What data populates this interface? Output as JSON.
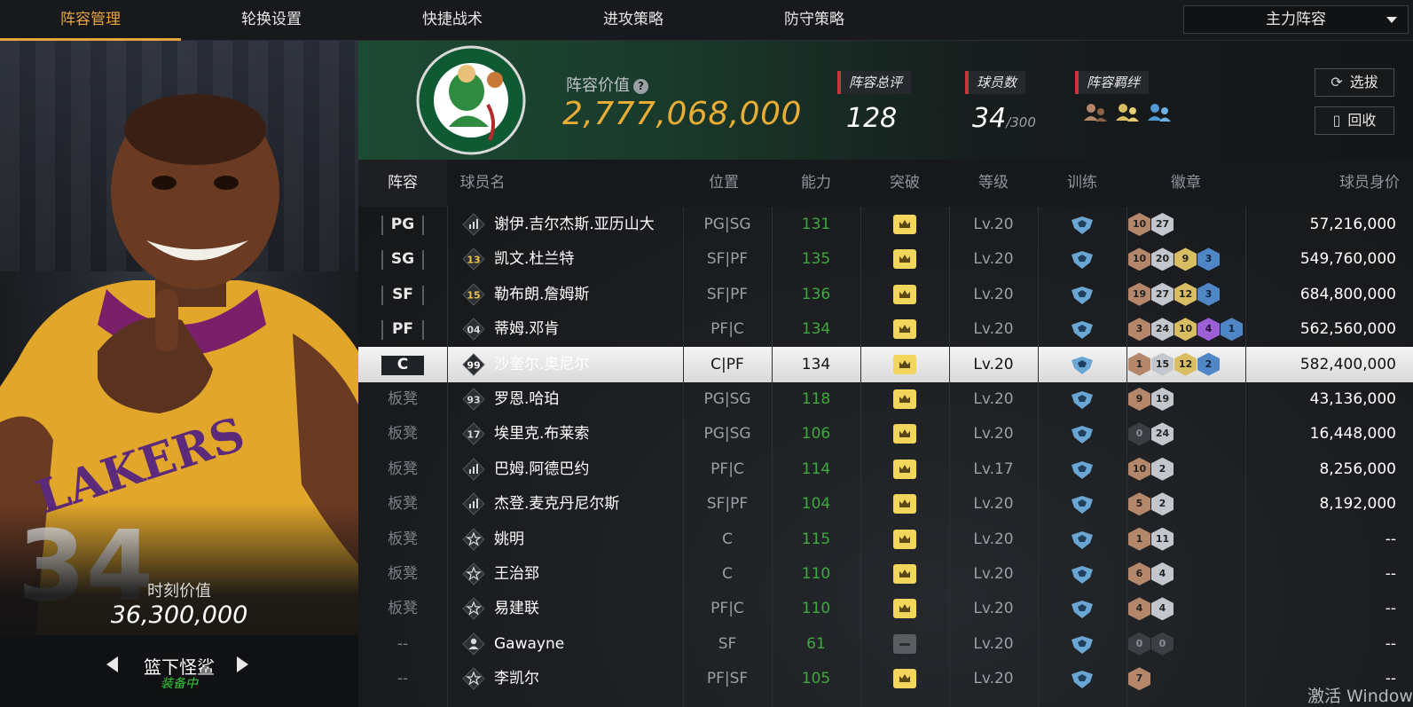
{
  "tabs": [
    {
      "label": "阵容管理",
      "active": true
    },
    {
      "label": "轮换设置",
      "active": false
    },
    {
      "label": "快捷战术",
      "active": false
    },
    {
      "label": "进攻策略",
      "active": false
    },
    {
      "label": "防守策略",
      "active": false
    }
  ],
  "lineup_select": {
    "value": "主力阵容"
  },
  "player_card": {
    "moment_label": "时刻价值",
    "moment_value": "36,300,000",
    "card_name": "篮下怪鲨",
    "status": "装备中"
  },
  "team": {
    "value_label": "阵容价值",
    "value": "2,777,068,000",
    "rating_label": "阵容总评",
    "rating": "128",
    "players_label": "球员数",
    "players": "34",
    "players_max": "/300",
    "bond_label": "阵容羁绊",
    "bond_icons": [
      "bond-bronze-icon",
      "bond-gold-icon",
      "bond-blue-icon"
    ],
    "scout_button": "选拔",
    "recycle_button": "回收"
  },
  "columns": [
    "阵容",
    "球员名",
    "位置",
    "能力",
    "突破",
    "等级",
    "训练",
    "徽章",
    "球员身价"
  ],
  "rows": [
    {
      "slot": "PG",
      "slot_type": "starter",
      "num_icon": "stat",
      "name": "谢伊.吉尔杰斯.亚历山大",
      "pos": "PG|SG",
      "ability": "131",
      "breakthrough": "crown",
      "level": "Lv.20",
      "badges": [
        [
          "10",
          "bronze"
        ],
        [
          "27",
          "silver"
        ]
      ],
      "value": "57,216,000"
    },
    {
      "slot": "SG",
      "slot_type": "starter",
      "num_icon": "13",
      "name": "凯文.杜兰特",
      "pos": "SF|PF",
      "ability": "135",
      "breakthrough": "crown",
      "level": "Lv.20",
      "badges": [
        [
          "10",
          "bronze"
        ],
        [
          "20",
          "silver"
        ],
        [
          "9",
          "gold"
        ],
        [
          "3",
          "blue"
        ]
      ],
      "value": "549,760,000"
    },
    {
      "slot": "SF",
      "slot_type": "starter",
      "num_icon": "15",
      "name": "勒布朗.詹姆斯",
      "pos": "SF|PF",
      "ability": "136",
      "breakthrough": "crown",
      "level": "Lv.20",
      "badges": [
        [
          "19",
          "bronze"
        ],
        [
          "27",
          "silver"
        ],
        [
          "12",
          "gold"
        ],
        [
          "3",
          "blue"
        ]
      ],
      "value": "684,800,000"
    },
    {
      "slot": "PF",
      "slot_type": "starter",
      "num_icon": "04",
      "name": "蒂姆.邓肯",
      "pos": "PF|C",
      "ability": "134",
      "breakthrough": "crown",
      "level": "Lv.20",
      "badges": [
        [
          "3",
          "bronze"
        ],
        [
          "24",
          "silver"
        ],
        [
          "10",
          "gold"
        ],
        [
          "4",
          "purple"
        ],
        [
          "1",
          "blue"
        ]
      ],
      "value": "562,560,000"
    },
    {
      "slot": "C",
      "slot_type": "selected",
      "num_icon": "99",
      "name": "沙奎尔.奥尼尔",
      "pos": "C|PF",
      "ability": "134",
      "breakthrough": "crown",
      "level": "Lv.20",
      "badges": [
        [
          "1",
          "bronze"
        ],
        [
          "15",
          "silver"
        ],
        [
          "12",
          "gold"
        ],
        [
          "2",
          "blue"
        ]
      ],
      "value": "582,400,000"
    },
    {
      "slot": "板凳",
      "slot_type": "bench",
      "num_icon": "93",
      "name": "罗恩.哈珀",
      "pos": "PG|SG",
      "ability": "118",
      "breakthrough": "crown",
      "level": "Lv.20",
      "badges": [
        [
          "9",
          "bronze"
        ],
        [
          "19",
          "silver"
        ]
      ],
      "value": "43,136,000"
    },
    {
      "slot": "板凳",
      "slot_type": "bench",
      "num_icon": "17",
      "name": "埃里克.布莱索",
      "pos": "PG|SG",
      "ability": "106",
      "breakthrough": "crown",
      "level": "Lv.20",
      "badges": [
        [
          "0",
          "dark"
        ],
        [
          "24",
          "silver"
        ]
      ],
      "value": "16,448,000"
    },
    {
      "slot": "板凳",
      "slot_type": "bench",
      "num_icon": "stat",
      "name": "巴姆.阿德巴约",
      "pos": "PF|C",
      "ability": "114",
      "breakthrough": "crown",
      "level": "Lv.17",
      "badges": [
        [
          "10",
          "bronze"
        ],
        [
          "2",
          "silver"
        ]
      ],
      "value": "8,256,000"
    },
    {
      "slot": "板凳",
      "slot_type": "bench",
      "num_icon": "stat",
      "name": "杰登.麦克丹尼尔斯",
      "pos": "SF|PF",
      "ability": "104",
      "breakthrough": "crown",
      "level": "Lv.20",
      "badges": [
        [
          "5",
          "bronze"
        ],
        [
          "2",
          "silver"
        ]
      ],
      "value": "8,192,000"
    },
    {
      "slot": "板凳",
      "slot_type": "bench",
      "num_icon": "star",
      "name": "姚明",
      "pos": "C",
      "ability": "115",
      "breakthrough": "crown",
      "level": "Lv.20",
      "badges": [
        [
          "1",
          "bronze"
        ],
        [
          "11",
          "silver"
        ]
      ],
      "value": "--"
    },
    {
      "slot": "板凳",
      "slot_type": "bench",
      "num_icon": "star",
      "name": "王治郅",
      "pos": "C",
      "ability": "110",
      "breakthrough": "crown",
      "level": "Lv.20",
      "badges": [
        [
          "6",
          "bronze"
        ],
        [
          "4",
          "silver"
        ]
      ],
      "value": "--"
    },
    {
      "slot": "板凳",
      "slot_type": "bench",
      "num_icon": "star",
      "name": "易建联",
      "pos": "PF|C",
      "ability": "110",
      "breakthrough": "crown",
      "level": "Lv.20",
      "badges": [
        [
          "4",
          "bronze"
        ],
        [
          "4",
          "silver"
        ]
      ],
      "value": "--"
    },
    {
      "slot": "--",
      "slot_type": "none",
      "num_icon": "person",
      "name": "Gawayne",
      "pos": "SF",
      "ability": "61",
      "breakthrough": "locked",
      "level": "Lv.20",
      "badges": [
        [
          "0",
          "dark"
        ],
        [
          "0",
          "dark"
        ]
      ],
      "value": "--"
    },
    {
      "slot": "--",
      "slot_type": "none",
      "num_icon": "star",
      "name": "李凯尔",
      "pos": "PF|SF",
      "ability": "105",
      "breakthrough": "crown",
      "level": "Lv.20",
      "badges": [
        [
          "7",
          "bronze"
        ]
      ],
      "value": "--"
    }
  ],
  "watermark": "激活 Window",
  "colors": {
    "accent": "#e7a53e",
    "ability_green": "#3fa83f",
    "status_green": "#36c93a",
    "team_green": "#1d4a33"
  }
}
